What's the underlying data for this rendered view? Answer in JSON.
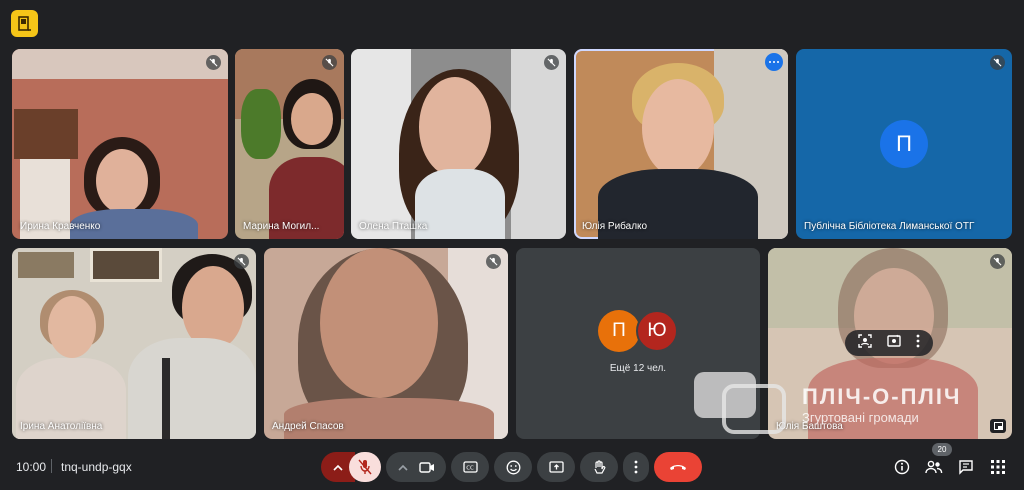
{
  "meeting": {
    "time": "10:00",
    "code": "tnq-undp-gqx"
  },
  "participants": [
    {
      "name": "Ирина Кравченко"
    },
    {
      "name": "Марина Могил..."
    },
    {
      "name": "Олена Пташка"
    },
    {
      "name": "Юлія Рибалко"
    },
    {
      "name": "Публічна Бібліотека Лиманської ОТГ",
      "initial": "П"
    },
    {
      "name": "Ірина Анатоліївна"
    },
    {
      "name": "Андрей Спасов"
    },
    {
      "name": "Юлія Баштова"
    }
  ],
  "others": {
    "initials": [
      "П",
      "Ю"
    ],
    "label": "Ещё 12 чел."
  },
  "watermark": {
    "title": "ПЛІЧ-О-ПЛІЧ",
    "subtitle": "Згуртовані громади"
  },
  "people_count": "20",
  "colors": {
    "accent": "#1a73e8",
    "hangup": "#ea4335",
    "orange": "#e8710a",
    "darkred": "#b3261e"
  }
}
